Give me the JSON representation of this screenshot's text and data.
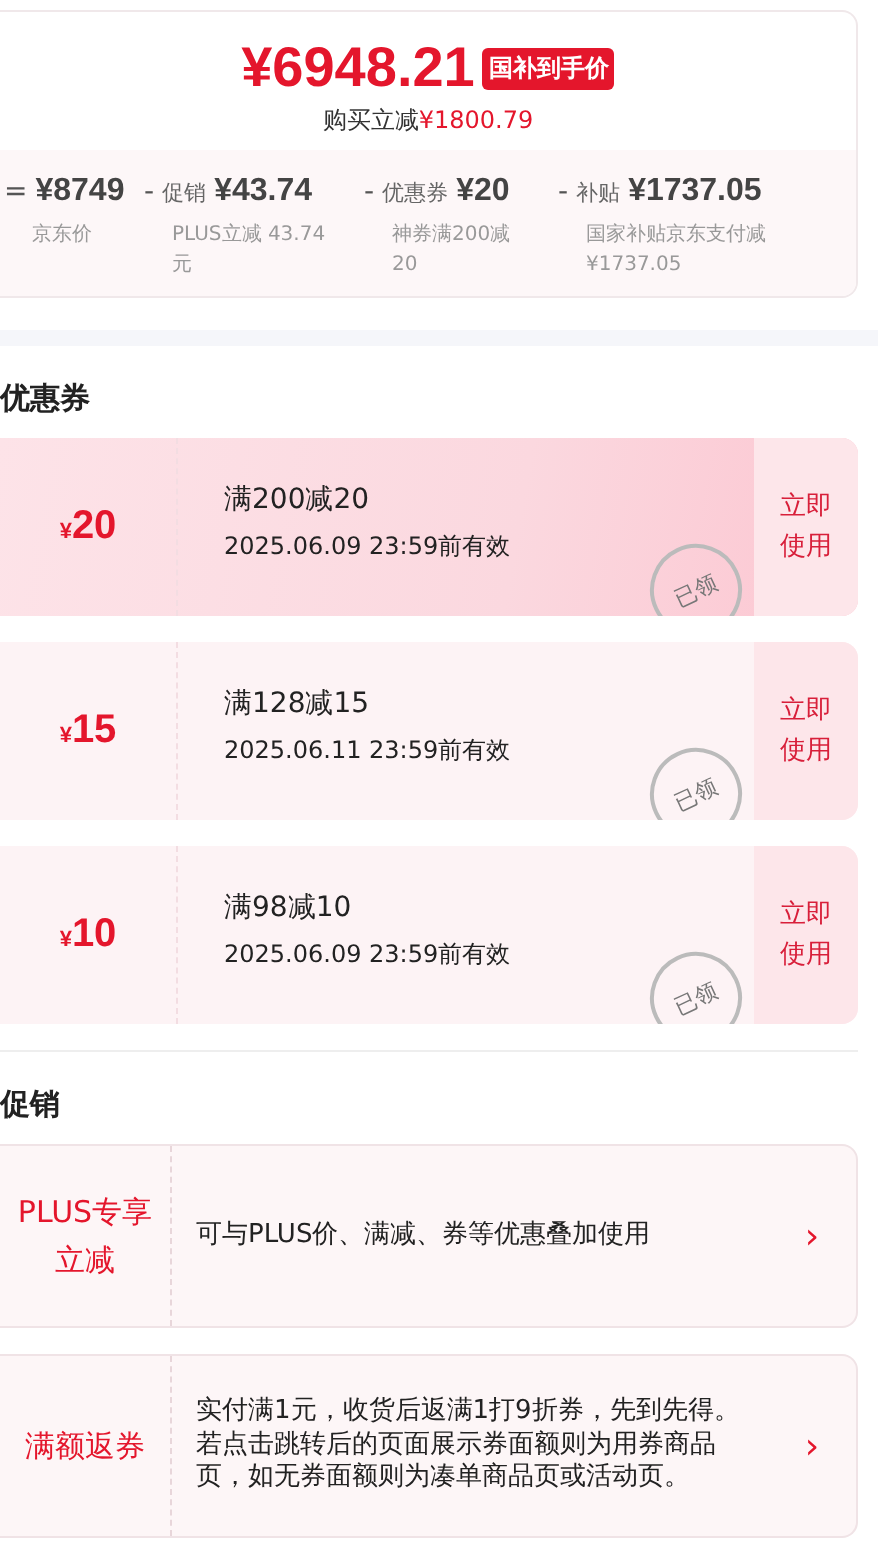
{
  "price": {
    "amount": "6948.21",
    "currency": "¥",
    "badge": "国补到手价",
    "saving_label": "购买立减",
    "saving_amount": "¥1800.79"
  },
  "breakdown": [
    {
      "operator": "=",
      "amount": "¥8749",
      "desc": "京东价"
    },
    {
      "operator": "-",
      "label": "促销",
      "amount": "¥43.74",
      "desc": "PLUS立减 43.74元"
    },
    {
      "operator": "-",
      "label": "优惠券",
      "amount": "¥20",
      "desc": "神券满200减20"
    },
    {
      "operator": "-",
      "label": "补贴",
      "amount": "¥1737.05",
      "desc": "国家补贴京东支付减¥1737.05"
    }
  ],
  "coupons_title": "优惠券",
  "coupons": [
    {
      "currency": "¥",
      "value": "20",
      "condition": "满200减20",
      "validity": "2025.06.09 23:59前有效",
      "stamp": "已领",
      "action": "立即使用",
      "highlighted": true
    },
    {
      "currency": "¥",
      "value": "15",
      "condition": "满128减15",
      "validity": "2025.06.11 23:59前有效",
      "stamp": "已领",
      "action": "立即使用",
      "highlighted": false
    },
    {
      "currency": "¥",
      "value": "10",
      "condition": "满98减10",
      "validity": "2025.06.09 23:59前有效",
      "stamp": "已领",
      "action": "立即使用",
      "highlighted": false
    }
  ],
  "promotions_title": "促销",
  "promotions": [
    {
      "tag": "PLUS专享立减",
      "text": "可与PLUS价、满减、券等优惠叠加使用",
      "arrow": "›"
    },
    {
      "tag": "满额返券",
      "text": "实付满1元，收货后返满1打9折券，先到先得。若点击跳转后的页面展示券面额则为用券商品页，如无券面额则为凑单商品页或活动页。",
      "arrow": "›"
    }
  ]
}
